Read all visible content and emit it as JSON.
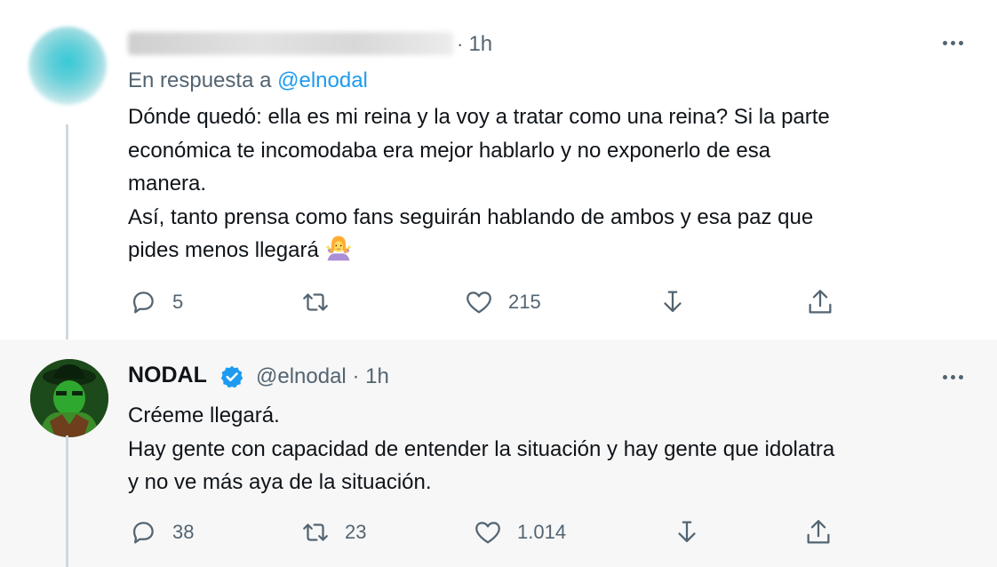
{
  "tweets": [
    {
      "time_sep": "·",
      "time": "1h",
      "reply_prefix": "En respuesta a",
      "reply_handle": "@elnodal",
      "lines": [
        "Dónde quedó: ella es mi reina y la voy a tratar como una reina? Si la parte",
        "económica te incomodaba era mejor hablarlo y no exponerlo de esa",
        "manera.",
        "Así, tanto prensa como fans seguirán hablando de ambos y esa paz que",
        "pides menos llegará"
      ],
      "emoji": "woman-shrugging-icon",
      "replies": "5",
      "retweets": "",
      "likes": "215"
    },
    {
      "name": "NODAL",
      "handle": "@elnodal",
      "time_sep": "·",
      "time": "1h",
      "lines": [
        "Créeme llegará.",
        "Hay gente con capacidad de entender la situación y hay gente que idolatra",
        "y no ve más aya de la situación."
      ],
      "replies": "38",
      "retweets": "23",
      "likes": "1.014"
    }
  ],
  "colors": {
    "text": "#0f1419",
    "secondary": "#536471",
    "link": "#1d9bf0",
    "verified": "#1d9bf0",
    "highlight_bg": "#f7f7f7"
  },
  "icons": [
    "reply-icon",
    "retweet-icon",
    "like-icon",
    "save-icon",
    "share-icon",
    "more-icon",
    "verified-badge-icon"
  ]
}
